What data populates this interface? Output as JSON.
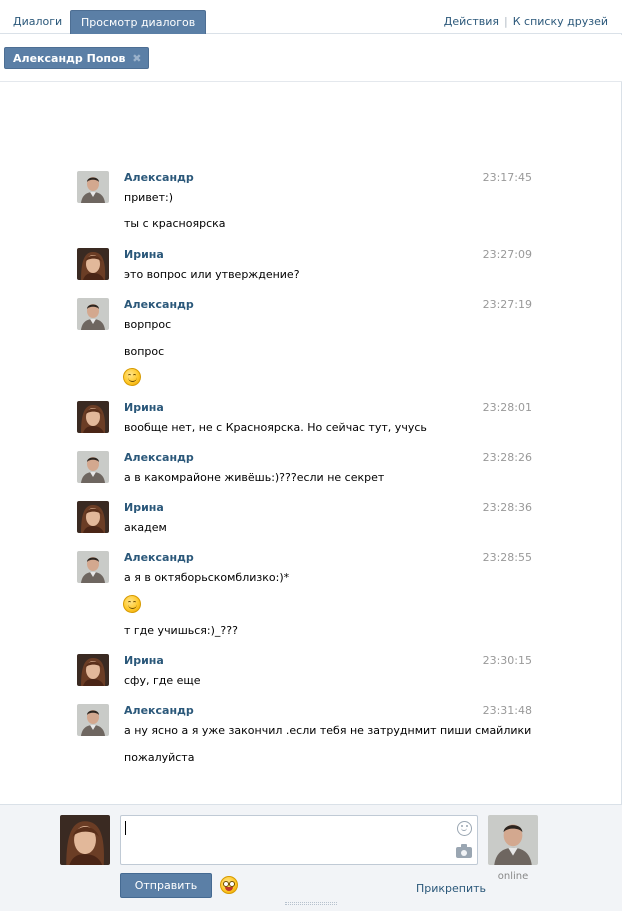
{
  "tabs": [
    {
      "label": "Диалоги",
      "active": false
    },
    {
      "label": "Просмотр диалогов",
      "active": true
    }
  ],
  "top_links": {
    "actions": "Действия",
    "separator": "|",
    "friends": "К списку друзей"
  },
  "recipient": {
    "name": "Александр Попов",
    "remove_glyph": "✖"
  },
  "messages": [
    {
      "author": "Александр",
      "avatar": "alexander",
      "time": "23:17:45",
      "lines": [
        "привет:)",
        "ты с красноярска"
      ]
    },
    {
      "author": "Ирина",
      "avatar": "irina",
      "time": "23:27:09",
      "lines": [
        "это вопрос или утверждение?"
      ]
    },
    {
      "author": "Александр",
      "avatar": "alexander",
      "time": "23:27:19",
      "lines": [
        "ворпрос",
        "вопрос"
      ],
      "smile": true
    },
    {
      "author": "Ирина",
      "avatar": "irina",
      "time": "23:28:01",
      "lines": [
        "вообще нет, не с Красноярска. Но сейчас тут, учусь"
      ]
    },
    {
      "author": "Александр",
      "avatar": "alexander",
      "time": "23:28:26",
      "lines": [
        "а в какомрайоне живёшь:)???если не секрет"
      ]
    },
    {
      "author": "Ирина",
      "avatar": "irina",
      "time": "23:28:36",
      "lines": [
        "академ"
      ]
    },
    {
      "author": "Александр",
      "avatar": "alexander",
      "time": "23:28:55",
      "lines": [
        "а я в октяборьскомблизко:)*",
        "т где учишься:)_???"
      ],
      "smile": true
    },
    {
      "author": "Ирина",
      "avatar": "irina",
      "time": "23:30:15",
      "lines": [
        "сфу, где еще"
      ]
    },
    {
      "author": "Александр",
      "avatar": "alexander",
      "time": "23:31:48",
      "lines": [
        "а ну ясно а я уже закончил .если тебя не затруднмит пиши смайлики",
        "пожалуйста"
      ]
    }
  ],
  "compose": {
    "send_label": "Отправить",
    "attach_label": "Прикрепить",
    "peer_status": "online"
  },
  "colors": {
    "accent": "#5b7fa6",
    "link": "#2b587a",
    "time": "#999999",
    "compose_bg": "#f2f4f7"
  }
}
